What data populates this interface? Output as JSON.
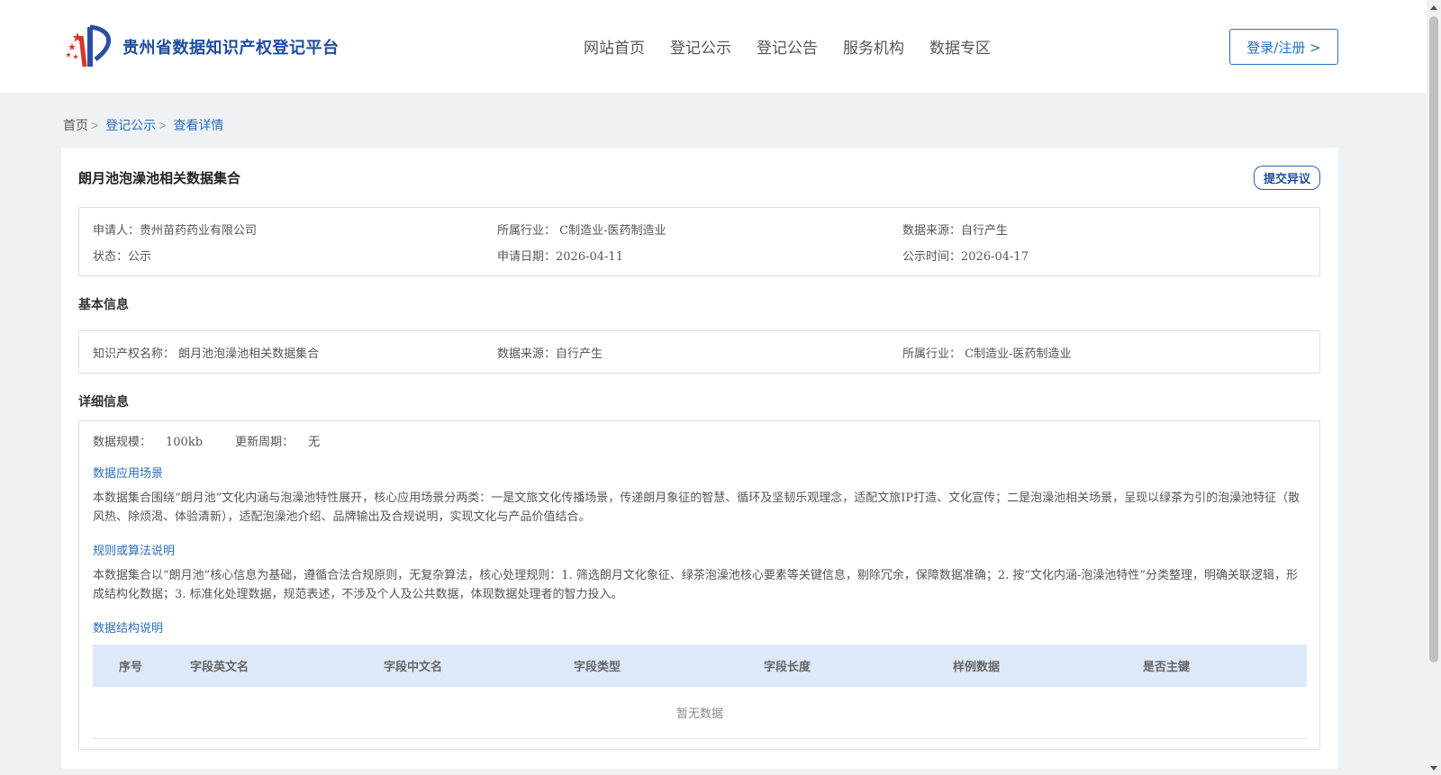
{
  "header": {
    "logo_text": "贵州省数据知识产权登记平台",
    "nav": [
      "网站首页",
      "登记公示",
      "登记公告",
      "服务机构",
      "数据专区"
    ],
    "login_label": "登录/注册 >"
  },
  "breadcrumb": {
    "home": "首页",
    "sep": ">",
    "items": [
      "登记公示",
      "查看详情"
    ]
  },
  "detail": {
    "title": "朗月池泡澡池相关数据集合",
    "objection_label": "提交异议",
    "summary": {
      "applicant_label": "申请人：",
      "applicant": "贵州苗药药业有限公司",
      "industry_label": "所属行业：",
      "industry": "C制造业-医药制造业",
      "source_label": "数据来源：",
      "source": "自行产生",
      "status_label": "状态：",
      "status": "公示",
      "apply_date_label": "申请日期：",
      "apply_date": "2026-04-11",
      "publish_date_label": "公示时间：",
      "publish_date": "2026-04-17"
    },
    "basic": {
      "section_title": "基本信息",
      "ip_name_label": "知识产权名称：",
      "ip_name": "朗月池泡澡池相关数据集合",
      "source_label": "数据来源：",
      "source": "自行产生",
      "industry_label": "所属行业：",
      "industry": "C制造业-医药制造业"
    },
    "detailed": {
      "section_title": "详细信息",
      "scale_label": "数据规模：",
      "scale": "100kb",
      "update_label": "更新周期：",
      "update": "无",
      "scenario_title": "数据应用场景",
      "scenario_text": "本数据集合围绕“朗月池”文化内涵与泡澡池特性展开，核心应用场景分两类：一是文旅文化传播场景，传递朗月象征的智慧、循环及坚韧乐观理念，适配文旅IP打造、文化宣传；二是泡澡池相关场景，呈现以绿茶为引的泡澡池特征（散风热、除烦渴、体验清新），适配泡澡池介绍、品牌输出及合规说明，实现文化与产品价值结合。",
      "rules_title": "规则或算法说明",
      "rules_text": "本数据集合以“朗月池”核心信息为基础，遵循合法合规原则，无复杂算法，核心处理规则：1. 筛选朗月文化象征、绿茶泡澡池核心要素等关键信息，剔除冗余，保障数据准确；2. 按“文化内涵-泡澡池特性”分类整理，明确关联逻辑，形成结构化数据；3. 标准化处理数据，规范表述，不涉及个人及公共数据，体现数据处理者的智力投入。",
      "structure_title": "数据结构说明",
      "table_headers": [
        "序号",
        "字段英文名",
        "字段中文名",
        "字段类型",
        "字段长度",
        "样例数据",
        "是否主键"
      ],
      "empty_text": "暂无数据"
    }
  },
  "colors": {
    "brand": "#1f4d9c",
    "link": "#2c6dbf",
    "table_header_bg": "#dde9f8",
    "page_bg": "#eef2f5"
  }
}
